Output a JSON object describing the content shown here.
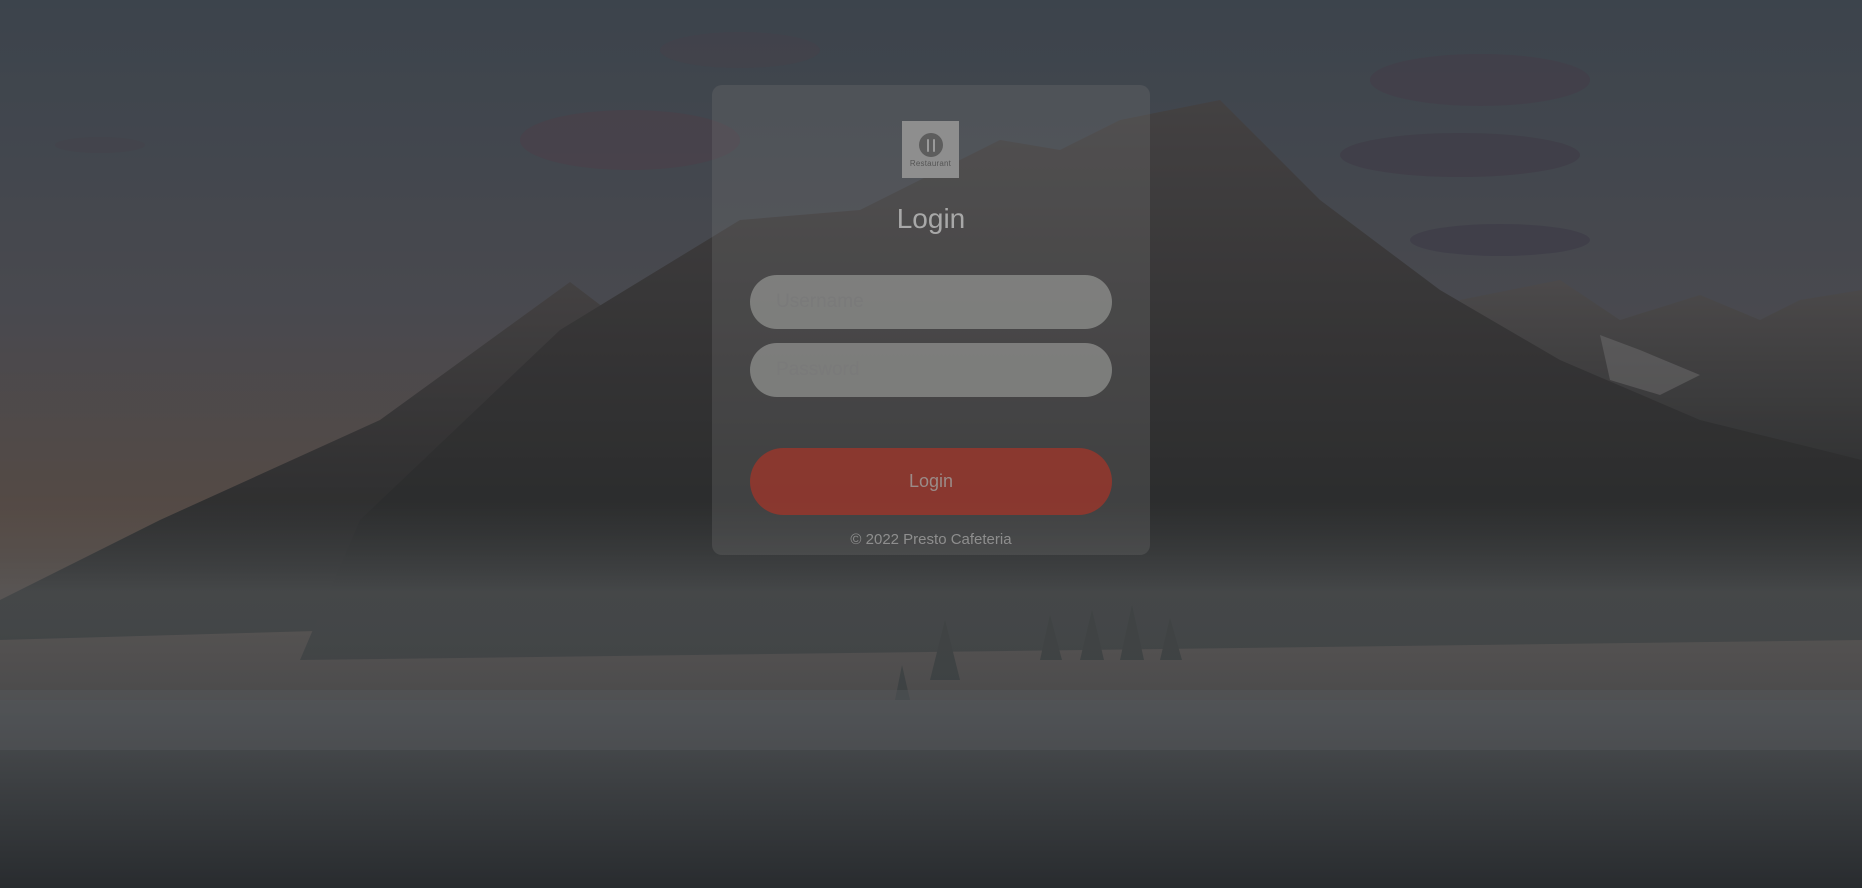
{
  "login_card": {
    "logo_text": "Restaurant",
    "title": "Login",
    "username_placeholder": "Username",
    "password_placeholder": "Password",
    "login_button_label": "Login",
    "footer_text": "© 2022 Presto Cafeteria"
  },
  "colors": {
    "login_button": "#96362c",
    "card_overlay": "#787878",
    "input_background": "#aaaca8"
  }
}
